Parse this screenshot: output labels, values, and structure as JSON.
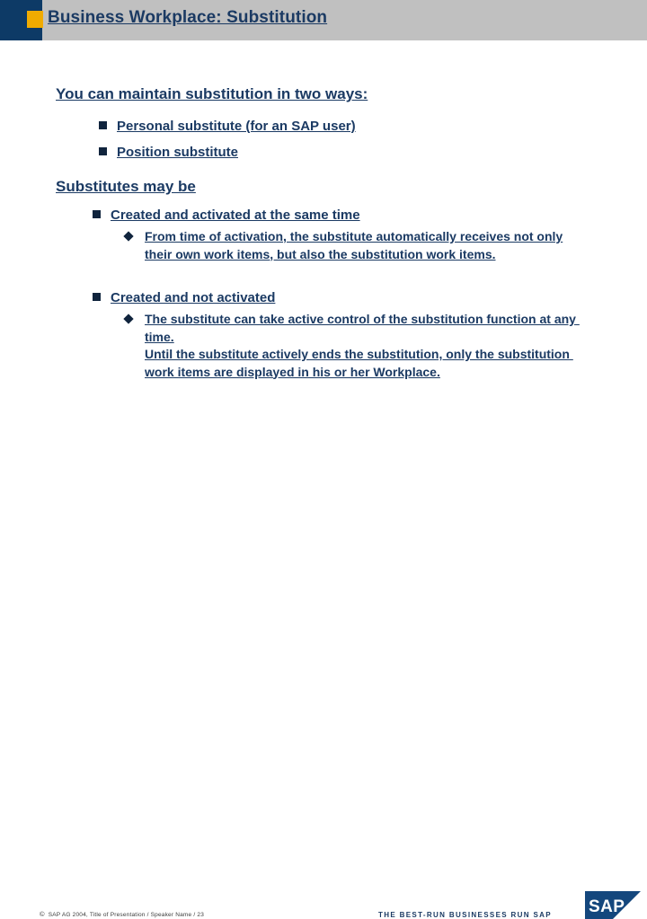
{
  "header": {
    "title": "Business Workplace: Substitution",
    "accent_color": "#f0ab00",
    "navy_color": "#0d3a66",
    "band_color": "#c0c0c0"
  },
  "slide": {
    "sections": [
      {
        "heading": "You can maintain substitution in two ways:",
        "bullets": [
          "Personal substitute (for an SAP user)",
          "Position substitute"
        ]
      },
      {
        "heading": "Substitutes may be",
        "bullets": [
          "Created and activated at the same time",
          "Created and not activated"
        ],
        "subbullets": [
          "From time of activation, the substitute automatically receives not only their own work items, but also the substitution work items.",
          "The substitute can take active control of the substitution function at any time.\nUntil the substitute actively ends the substitution, only the substitution work items are displayed in his or her Workplace."
        ]
      }
    ],
    "text_color": "#1b3a63",
    "marker_color": "#10243d"
  },
  "footer": {
    "copyright_mark": "©",
    "copyright": "SAP AG 2004, Title of Presentation / Speaker Name / 23",
    "tagline": "THE BEST-RUN BUSINESSES RUN SAP",
    "logo_text": "SAP",
    "logo_registered": "®"
  }
}
